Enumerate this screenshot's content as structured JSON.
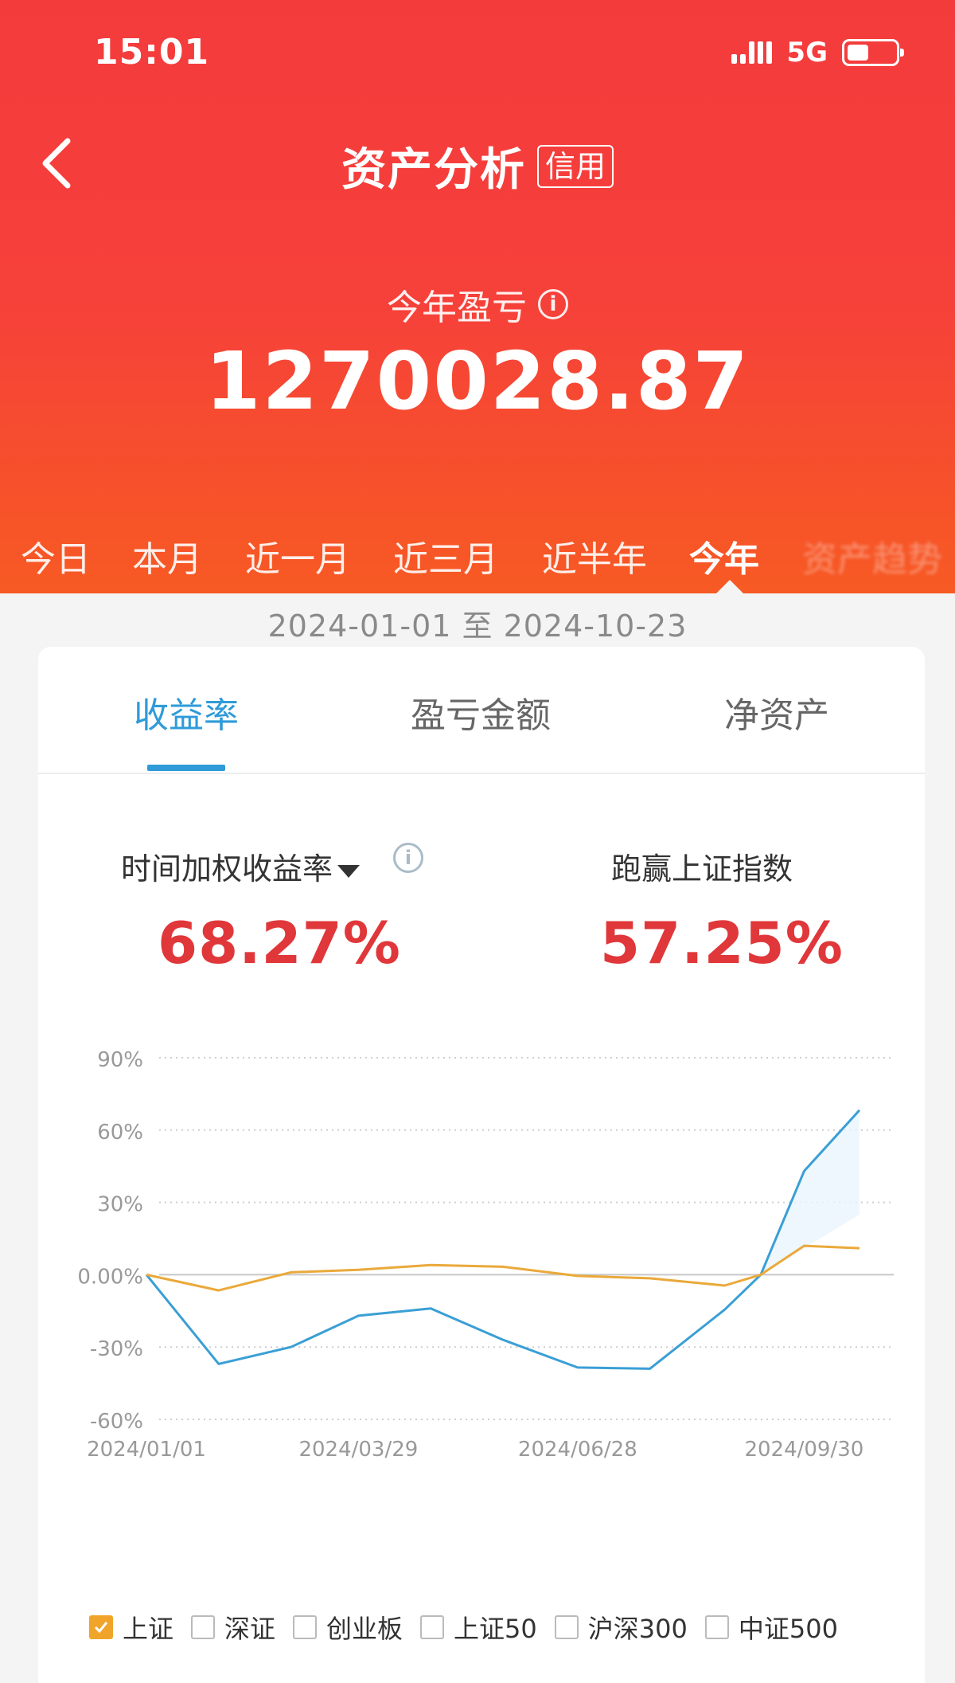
{
  "status": {
    "time": "15:01",
    "network": "5G"
  },
  "nav": {
    "title": "资产分析",
    "badge": "信用"
  },
  "summary": {
    "label": "今年盈亏",
    "value": "1270028.87"
  },
  "periods": [
    {
      "label": "今日"
    },
    {
      "label": "本月"
    },
    {
      "label": "近一月"
    },
    {
      "label": "近三月"
    },
    {
      "label": "近半年"
    },
    {
      "label": "今年"
    },
    {
      "label": "资产趋势"
    }
  ],
  "date_range": "2024-01-01 至 2024-10-23",
  "tabs": [
    {
      "label": "收益率"
    },
    {
      "label": "盈亏金额"
    },
    {
      "label": "净资产"
    }
  ],
  "metrics": {
    "weighted_label": "时间加权收益率",
    "weighted_value": "68.27%",
    "beat_label": "跑赢上证指数",
    "beat_value": "57.25%"
  },
  "legend": [
    {
      "label": "上证",
      "checked": true
    },
    {
      "label": "深证",
      "checked": false
    },
    {
      "label": "创业板",
      "checked": false
    },
    {
      "label": "上证50",
      "checked": false
    },
    {
      "label": "沪深300",
      "checked": false
    },
    {
      "label": "中证500",
      "checked": false
    }
  ],
  "chart_data": {
    "type": "line",
    "x_ticks": [
      "2024/01/01",
      "2024/03/29",
      "2024/06/28",
      "2024/09/30"
    ],
    "y_ticks": [
      "90%",
      "60%",
      "30%",
      "0.00%",
      "-30%",
      "-60%"
    ],
    "ylim": [
      -60,
      90
    ],
    "x": [
      "2024-01-01",
      "2024-01-31",
      "2024-03-01",
      "2024-03-29",
      "2024-04-28",
      "2024-05-28",
      "2024-06-28",
      "2024-07-28",
      "2024-08-28",
      "2024-09-12",
      "2024-09-30",
      "2024-10-23"
    ],
    "series": [
      {
        "color": "#3a9fd5",
        "values": [
          0,
          -37,
          -30,
          -17,
          -14,
          -27,
          -38.5,
          -39,
          -14.5,
          0,
          43,
          68.27
        ]
      },
      {
        "name": "上证",
        "color": "#eaa93a",
        "values": [
          0,
          -6.5,
          1,
          2,
          4,
          3.3,
          -0.5,
          -1.5,
          -4.5,
          0,
          12,
          11
        ]
      }
    ]
  }
}
